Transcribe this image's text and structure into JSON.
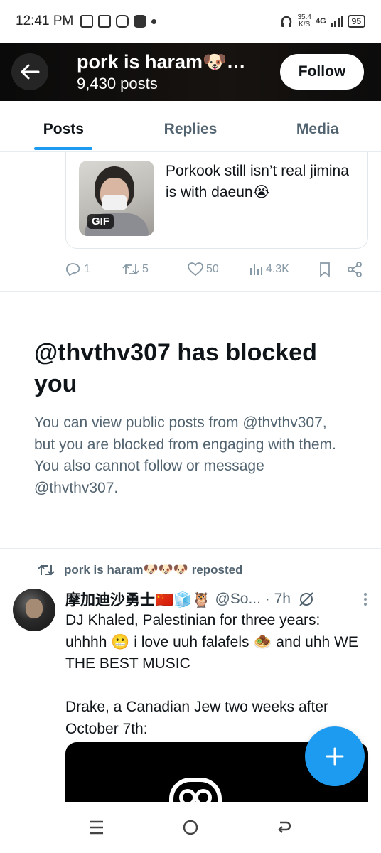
{
  "status_bar": {
    "time": "12:41 PM",
    "speed_value": "35.4",
    "speed_unit": "K/S",
    "network": "4G",
    "battery": "95"
  },
  "header": {
    "title": "pork is haram🐶…",
    "subtitle": "9,430 posts",
    "follow_label": "Follow"
  },
  "tabs": [
    {
      "label": "Posts",
      "active": true
    },
    {
      "label": "Replies",
      "active": false
    },
    {
      "label": "Media",
      "active": false
    }
  ],
  "quoted_post": {
    "gif_badge": "GIF",
    "text": "Porkook still isn’t real jimina is with daeun😭"
  },
  "actions": {
    "replies": "1",
    "reposts": "5",
    "likes": "50",
    "views": "4.3K"
  },
  "blocked": {
    "title": "@thvthv307 has blocked you",
    "description": "You can view public posts from @thvthv307, but you are blocked from engaging with them. You also cannot follow or message @thvthv307."
  },
  "repost": {
    "label": "pork is haram🐶🐶🐶 reposted",
    "author_name": "摩加迪沙勇士🇨🇳🧊🦉",
    "author_handle": "@So... · 7h",
    "text": "DJ Khaled, Palestinian for three years: uhhhh 😬 i love uuh falafels 🧆 and uhh WE THE BEST MUSIC\n\nDrake, a Canadian Jew two weeks after October 7th:"
  },
  "colors": {
    "accent": "#1d9bf0",
    "muted": "#536471",
    "header_bg": "#0a0a0a"
  },
  "icons": [
    "back-arrow-icon",
    "reply-icon",
    "repost-icon",
    "like-icon",
    "views-icon",
    "bookmark-icon",
    "share-icon",
    "grok-icon",
    "more-icon",
    "compose-icon",
    "menu-icon",
    "home-icon",
    "back-icon"
  ]
}
